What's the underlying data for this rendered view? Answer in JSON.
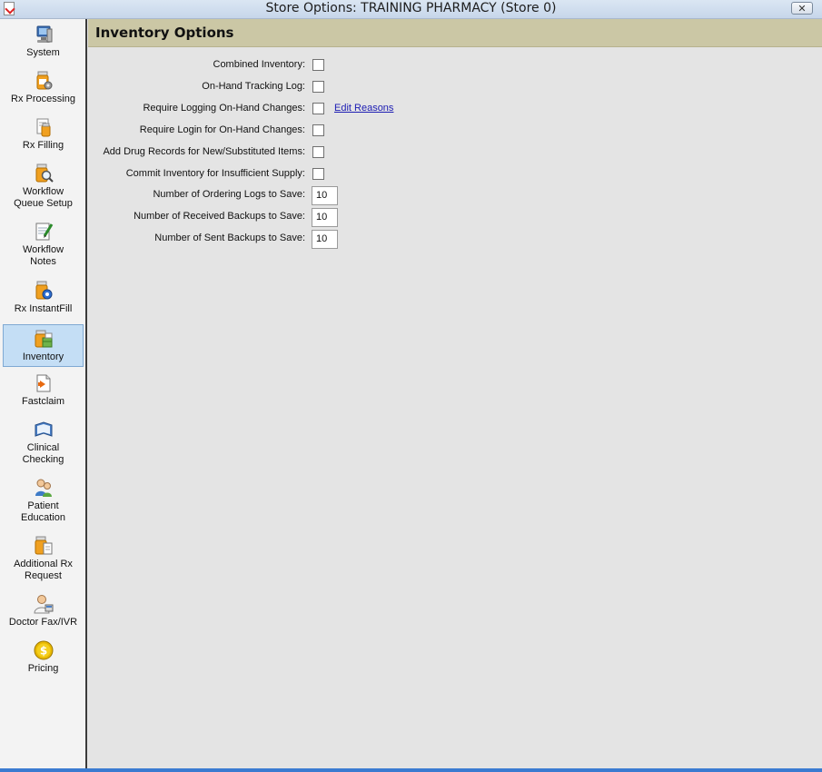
{
  "window": {
    "title": "Store Options: TRAINING PHARMACY (Store 0)",
    "close_label": "✕"
  },
  "sidebar": {
    "items": [
      {
        "id": "system",
        "label": "System",
        "icon": "computer-icon"
      },
      {
        "id": "rx-processing",
        "label": "Rx Processing",
        "icon": "pill-bottle-gear-icon"
      },
      {
        "id": "rx-filling",
        "label": "Rx Filling",
        "icon": "pill-bottle-document-icon"
      },
      {
        "id": "workflow-queue-setup",
        "label": "Workflow\nQueue Setup",
        "icon": "pill-bottle-search-icon"
      },
      {
        "id": "workflow-notes",
        "label": "Workflow\nNotes",
        "icon": "notepad-pencil-icon"
      },
      {
        "id": "rx-instantfill",
        "label": "Rx InstantFill",
        "icon": "pill-bottle-blue-icon"
      },
      {
        "id": "inventory",
        "label": "Inventory",
        "icon": "inventory-boxes-icon",
        "selected": true
      },
      {
        "id": "fastclaim",
        "label": "Fastclaim",
        "icon": "document-arrow-icon"
      },
      {
        "id": "clinical-checking",
        "label": "Clinical\nChecking",
        "icon": "book-icon"
      },
      {
        "id": "patient-education",
        "label": "Patient\nEducation",
        "icon": "people-icon"
      },
      {
        "id": "additional-rx-request",
        "label": "Additional Rx\nRequest",
        "icon": "pill-bottle-document-icon"
      },
      {
        "id": "doctor-fax-ivr",
        "label": "Doctor Fax/IVR",
        "icon": "doctor-icon"
      },
      {
        "id": "pricing",
        "label": "Pricing",
        "icon": "dollar-coin-icon"
      }
    ]
  },
  "main": {
    "section_title": "Inventory Options",
    "options": [
      {
        "label": "Combined Inventory:",
        "type": "checkbox",
        "checked": false
      },
      {
        "label": "On-Hand Tracking Log:",
        "type": "checkbox",
        "checked": false
      },
      {
        "label": "Require Logging On-Hand Changes:",
        "type": "checkbox",
        "checked": false,
        "link": "Edit Reasons"
      },
      {
        "label": "Require Login for On-Hand Changes:",
        "type": "checkbox",
        "checked": false
      },
      {
        "label": "Add Drug Records for New/Substituted Items:",
        "type": "checkbox",
        "checked": false
      },
      {
        "label": "Commit Inventory for Insufficient Supply:",
        "type": "checkbox",
        "checked": false
      },
      {
        "label": "Number of Ordering Logs to Save:",
        "type": "number",
        "value": "10"
      },
      {
        "label": "Number of Received Backups to Save:",
        "type": "number",
        "value": "10"
      },
      {
        "label": "Number of Sent Backups to Save:",
        "type": "number",
        "value": "10"
      }
    ]
  },
  "colors": {
    "header_band": "#cbc7a5",
    "selected_nav": "#c4def5",
    "link": "#1c1cb3",
    "taskbar_strip": "#3b7bd1"
  }
}
